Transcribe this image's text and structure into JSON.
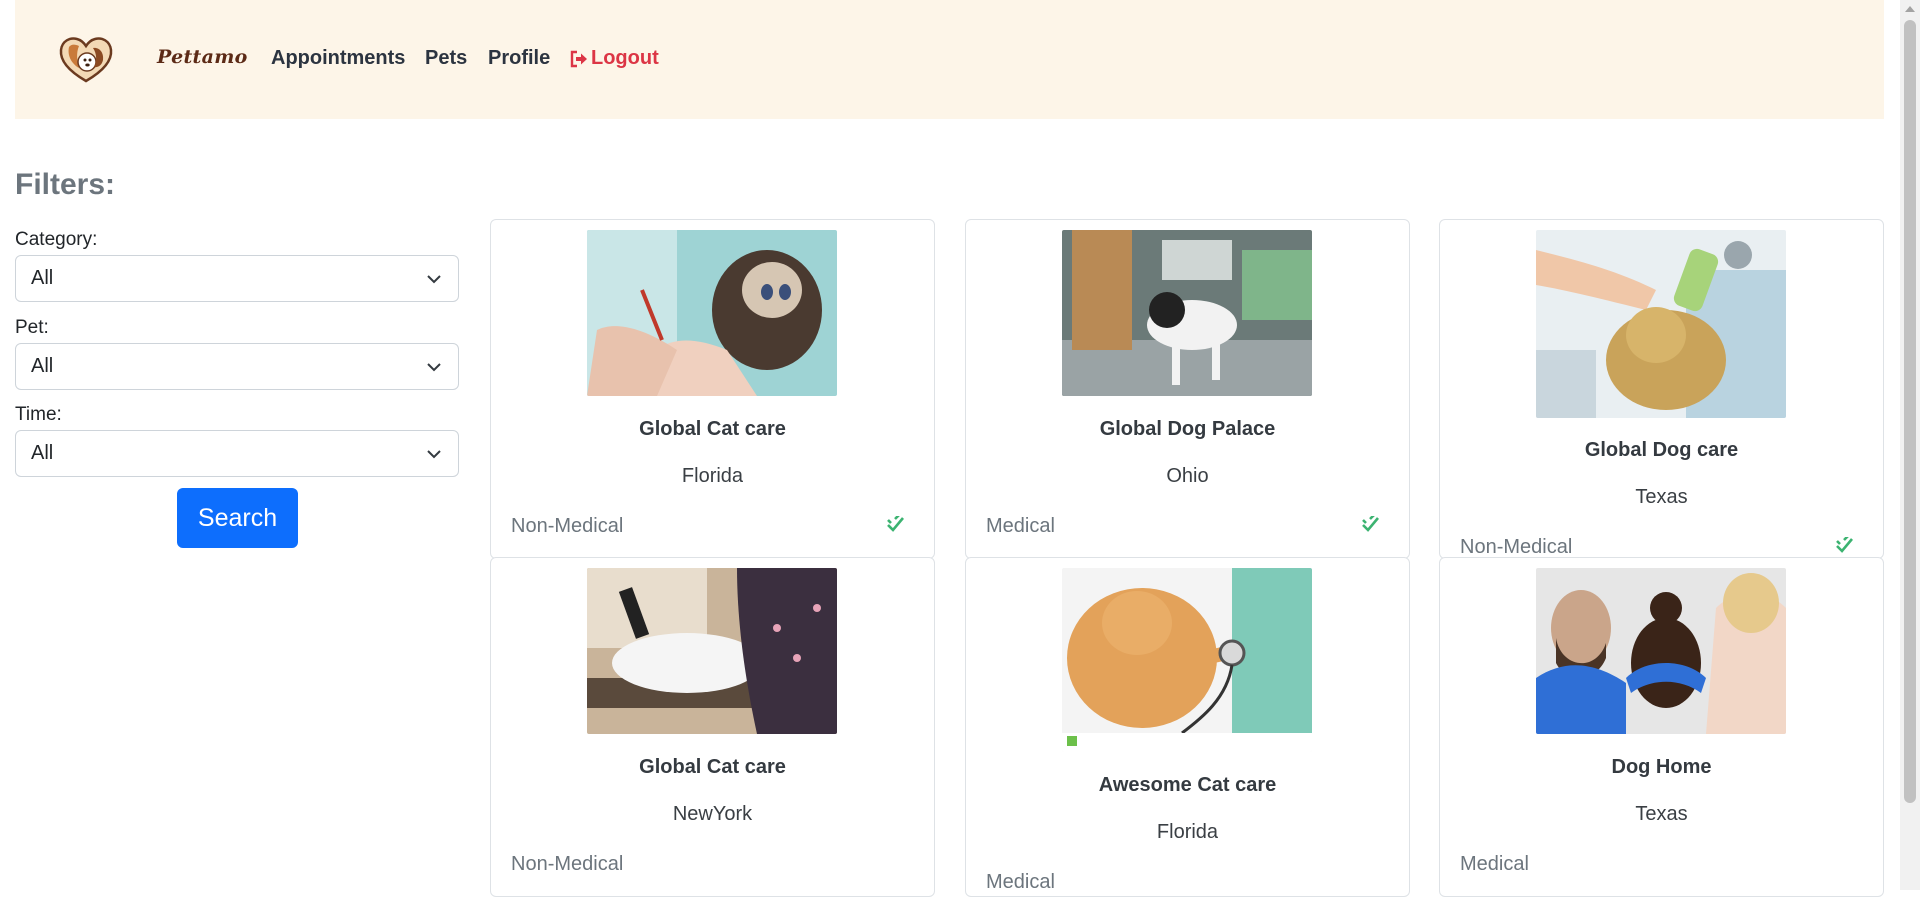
{
  "navbar": {
    "brand": "Pettamo",
    "links": [
      "Appointments",
      "Pets",
      "Profile"
    ],
    "logout": "Logout"
  },
  "filters": {
    "title": "Filters:",
    "category_label": "Category:",
    "category_value": "All",
    "pet_label": "Pet:",
    "pet_value": "All",
    "time_label": "Time:",
    "time_value": "All",
    "search_label": "Search"
  },
  "cards": [
    {
      "title": "Global Cat care",
      "location": "Florida",
      "category": "Non-Medical",
      "verified": true,
      "image": "cat-nail-trim"
    },
    {
      "title": "Global Dog Palace",
      "location": "Ohio",
      "category": "Medical",
      "verified": true,
      "image": "dog-vet-table"
    },
    {
      "title": "Global Dog care",
      "location": "Texas",
      "category": "Non-Medical",
      "verified": true,
      "image": "dog-bath-illustration"
    },
    {
      "title": "Global Cat care",
      "location": "NewYork",
      "category": "Non-Medical",
      "verified": false,
      "image": "cat-grooming"
    },
    {
      "title": "Awesome Cat care",
      "location": "Florida",
      "category": "Medical",
      "verified": false,
      "image": "cat-stethoscope"
    },
    {
      "title": "Dog Home",
      "location": "Texas",
      "category": "Medical",
      "verified": false,
      "image": "dog-vet-exam"
    }
  ],
  "colors": {
    "navbar_bg": "#fdf5e8",
    "primary": "#0d6efd",
    "logout": "#dc3545",
    "verified": "#3cb371"
  }
}
